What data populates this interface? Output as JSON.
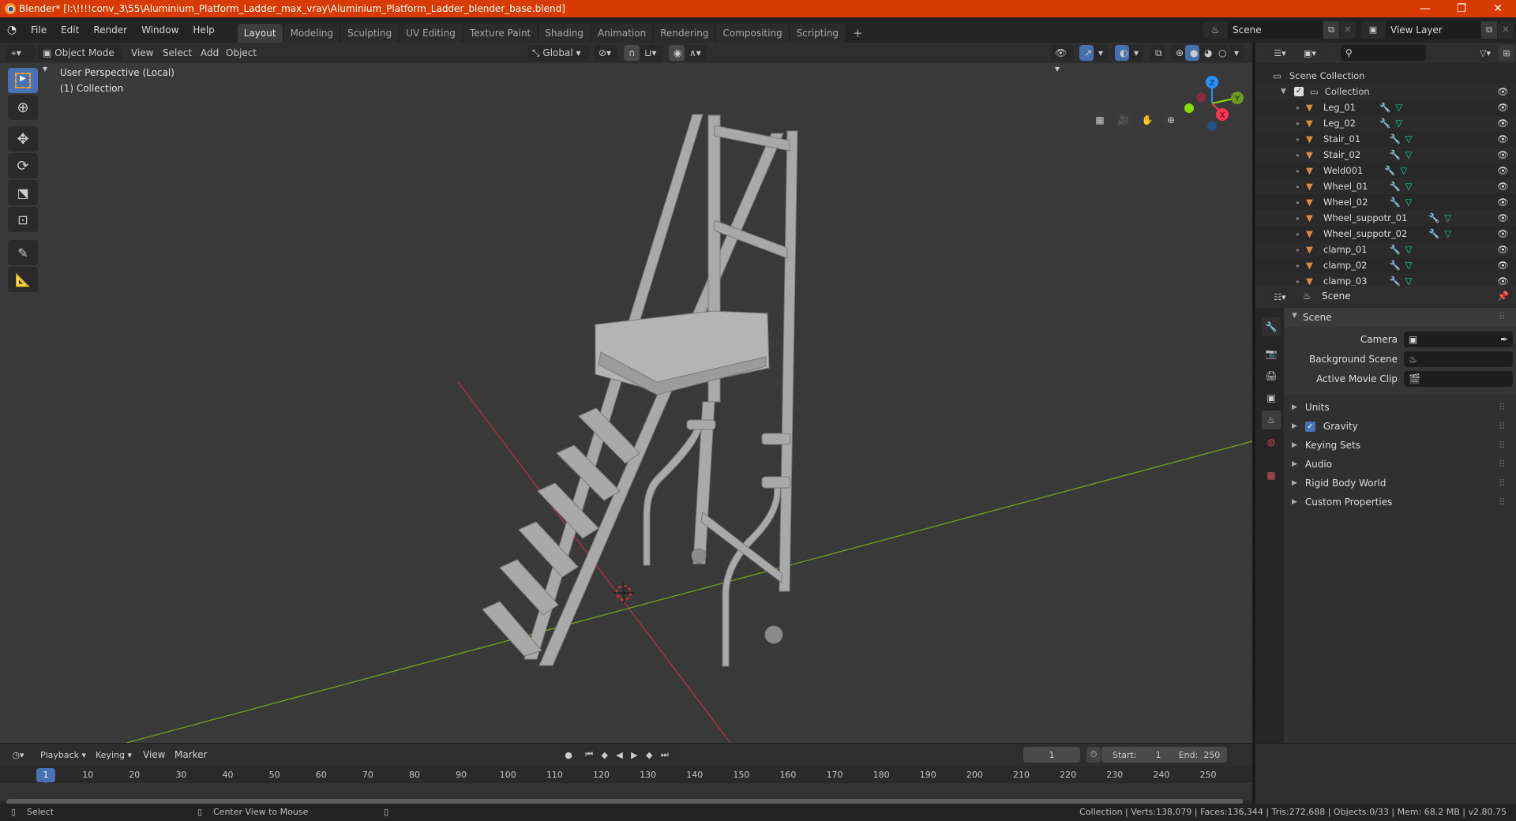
{
  "window": {
    "title": "Blender* [I:\\!!!!conv_3\\55\\Aluminium_Platform_Ladder_max_vray\\Aluminium_Platform_Ladder_blender_base.blend]",
    "controls": {
      "minimize": "—",
      "maximize": "❐",
      "close": "✕"
    }
  },
  "menubar": {
    "items": [
      "File",
      "Edit",
      "Render",
      "Window",
      "Help"
    ]
  },
  "workspaces": {
    "tabs": [
      "Layout",
      "Modeling",
      "Sculpting",
      "UV Editing",
      "Texture Paint",
      "Shading",
      "Animation",
      "Rendering",
      "Compositing",
      "Scripting"
    ],
    "active": "Layout",
    "add_label": "+"
  },
  "scene_selector": {
    "value": "Scene"
  },
  "view_layer_selector": {
    "value": "View Layer"
  },
  "viewport": {
    "mode": "Object Mode",
    "menus": [
      "View",
      "Select",
      "Add",
      "Object"
    ],
    "transform_orientation": "Global",
    "overlay_text": {
      "line1": "User Perspective (Local)",
      "line2": "(1) Collection"
    },
    "gizmo_axes": {
      "x": "X",
      "y": "Y",
      "z": "Z"
    },
    "colors": {
      "x_axis": "#ff3352",
      "y_axis": "#8bdc00",
      "z_axis": "#2890ff",
      "grid_red": "#a03040",
      "grid_green": "#6a9a20"
    }
  },
  "outliner": {
    "search_placeholder": "",
    "root": "Scene Collection",
    "collection": "Collection",
    "objects": [
      "Leg_01",
      "Leg_02",
      "Stair_01",
      "Stair_02",
      "Weld001",
      "Wheel_01",
      "Wheel_02",
      "Wheel_suppotr_01",
      "Wheel_suppotr_02",
      "clamp_01",
      "clamp_02",
      "clamp_03"
    ]
  },
  "properties": {
    "context": "Scene",
    "panel_title": "Scene",
    "fields": [
      {
        "label": "Camera",
        "value": ""
      },
      {
        "label": "Background Scene",
        "value": ""
      },
      {
        "label": "Active Movie Clip",
        "value": ""
      }
    ],
    "sections": [
      "Units",
      "Gravity",
      "Keying Sets",
      "Audio",
      "Rigid Body World",
      "Custom Properties"
    ],
    "gravity_enabled": true
  },
  "timeline": {
    "menus": [
      "Playback",
      "Keying",
      "View",
      "Marker"
    ],
    "current_frame": "1",
    "start_label": "Start:",
    "start": "1",
    "end_label": "End:",
    "end": "250",
    "ticks": [
      "10",
      "20",
      "30",
      "40",
      "50",
      "60",
      "70",
      "80",
      "90",
      "100",
      "110",
      "120",
      "130",
      "140",
      "150",
      "160",
      "170",
      "180",
      "190",
      "200",
      "210",
      "220",
      "230",
      "240",
      "250"
    ],
    "playhead_label": "1"
  },
  "statusbar": {
    "left_action": "Select",
    "middle_action": "Center View to Mouse",
    "stats": "Collection | Verts:138,079 | Faces:136,344 | Tris:272,688 | Objects:0/33 | Mem: 68.2 MB | v2.80.75"
  }
}
